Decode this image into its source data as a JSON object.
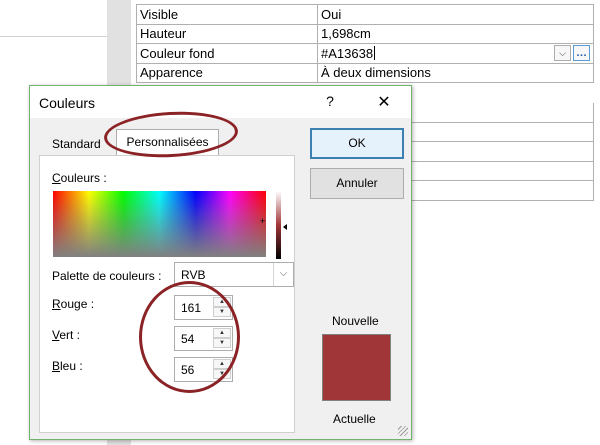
{
  "properties": [
    {
      "name": "Visible",
      "value": "Oui"
    },
    {
      "name": "Hauteur",
      "value": "1,698cm"
    },
    {
      "name": "Couleur fond",
      "value": "#A13638"
    },
    {
      "name": "Apparence",
      "value": "À deux dimensions"
    }
  ],
  "dialog": {
    "title": "Couleurs",
    "help": "?",
    "close": "✕",
    "tabs": {
      "standard": "Standard",
      "custom": "Personnalisées"
    },
    "colors_label_underlined": "C",
    "colors_label_rest": "ouleurs :",
    "palette_label": "Palette de couleurs :",
    "palette_value": "RVB",
    "red_label_underlined": "R",
    "red_label_rest": "ouge :",
    "red_value": "161",
    "green_label_underlined": "V",
    "green_label_rest": "ert :",
    "green_value": "54",
    "blue_label_underlined": "B",
    "blue_label_rest": "leu :",
    "blue_value": "56",
    "ok": "OK",
    "cancel": "Annuler",
    "new_label": "Nouvelle",
    "current_label": "Actuelle",
    "preview_color": "#A13638"
  },
  "icons": {
    "chevron_down": "⌵",
    "spin_up": "▲",
    "spin_down": "▼",
    "builder_button": "…"
  },
  "annotation_color": "#8B2326"
}
